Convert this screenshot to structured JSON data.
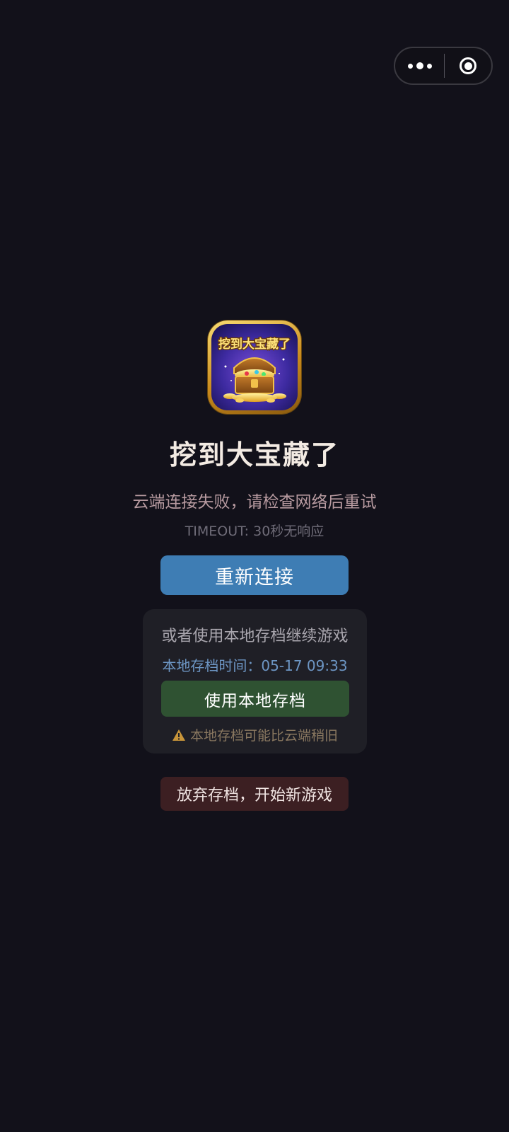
{
  "capsule": {
    "more_icon": "more-dots-icon",
    "close_icon": "target-close-icon"
  },
  "app": {
    "icon": "treasure-chest-icon",
    "icon_text": "挖到大宝藏了",
    "name": "挖到大宝藏了"
  },
  "status": {
    "error": "云端连接失败，请检查网络后重试",
    "timeout": "TIMEOUT: 30秒无响应"
  },
  "actions": {
    "reconnect_label": "重新连接",
    "discard_label": "放弃存档，开始新游戏"
  },
  "local_save": {
    "title": "或者使用本地存档继续游戏",
    "time_label": "本地存档时间：05-17 09:33",
    "use_label": "使用本地存档",
    "warning": "本地存档可能比云端稍旧",
    "warning_icon": "warning-triangle-icon"
  },
  "colors": {
    "background": "#12111a",
    "reconnect": "#3e7db4",
    "use_local": "#2f5232",
    "discard": "#3c1f22",
    "warning_icon": "#c8953a"
  }
}
